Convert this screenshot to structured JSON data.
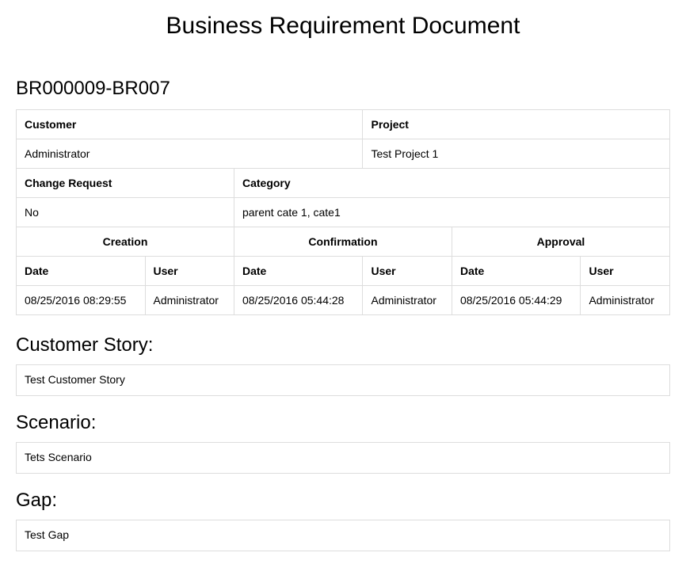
{
  "title": "Business Requirement Document",
  "docId": "BR000009-BR007",
  "meta": {
    "customerLabel": "Customer",
    "projectLabel": "Project",
    "customer": "Administrator",
    "project": "Test Project 1",
    "changeRequestLabel": "Change Request",
    "categoryLabel": "Category",
    "changeRequest": "No",
    "category": "parent cate 1, cate1",
    "creationLabel": "Creation",
    "confirmationLabel": "Confirmation",
    "approvalLabel": "Approval",
    "dateLabel": "Date",
    "userLabel": "User",
    "creation": {
      "date": "08/25/2016 08:29:55",
      "user": "Administrator"
    },
    "confirmation": {
      "date": "08/25/2016 05:44:28",
      "user": "Administrator"
    },
    "approval": {
      "date": "08/25/2016 05:44:29",
      "user": "Administrator"
    }
  },
  "sections": {
    "customerStory": {
      "heading": "Customer Story:",
      "content": "Test Customer Story"
    },
    "scenario": {
      "heading": "Scenario:",
      "content": "Tets Scenario"
    },
    "gap": {
      "heading": "Gap:",
      "content": "Test Gap"
    }
  }
}
